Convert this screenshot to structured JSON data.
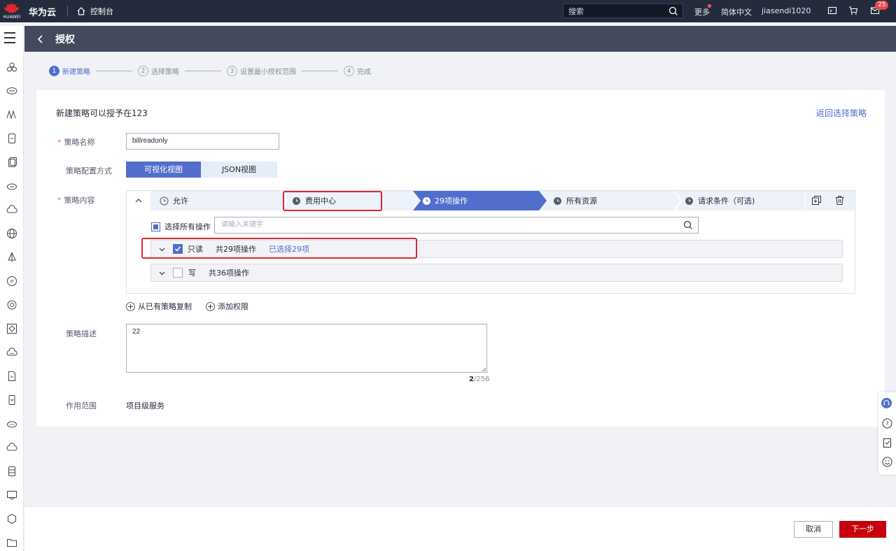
{
  "topbar": {
    "logo_word": "HUAWEI",
    "brand": "华为云",
    "console": "控制台",
    "search_placeholder": "搜索",
    "more": "更多",
    "language": "简体中文",
    "username": "jiasendi1020",
    "message_count": "25"
  },
  "titlebar": {
    "title": "授权"
  },
  "steps": [
    {
      "num": "1",
      "label": "新建策略"
    },
    {
      "num": "2",
      "label": "选择策略"
    },
    {
      "num": "3",
      "label": "设置最小授权范围"
    },
    {
      "num": "4",
      "label": "完成"
    }
  ],
  "form": {
    "header": "新建策略可以授予在123",
    "back_link": "返回选择策略",
    "name_label": "策略名称",
    "name_value": "billreadonly",
    "mode_label": "策略配置方式",
    "mode_visual": "可视化视图",
    "mode_json": "JSON视图",
    "content_label": "策略内容",
    "desc_label": "策略描述",
    "desc_value": "22",
    "desc_count_current": "2",
    "desc_count_max": "/256",
    "scope_label": "作用范围",
    "scope_value": "项目级服务"
  },
  "policy": {
    "crumbs": [
      "允许",
      "费用中心",
      "29项操作",
      "所有资源",
      "请求条件（可选)"
    ],
    "select_all": "选择所有操作",
    "keyword_placeholder": "请输入关键字",
    "rows": [
      {
        "type": "只读",
        "total": "共29项操作",
        "selected": "已选择29项",
        "checked": true
      },
      {
        "type": "写",
        "total": "共36项操作",
        "selected": "",
        "checked": false
      }
    ]
  },
  "links": {
    "copy": "从已有策略复制",
    "add": "添加权限"
  },
  "footer": {
    "cancel": "取消",
    "next": "下一步"
  },
  "colors": {
    "primary": "#526ecc",
    "brand_red": "#c7000b",
    "topbar": "#242b3d",
    "highlight": "#e0262e"
  }
}
